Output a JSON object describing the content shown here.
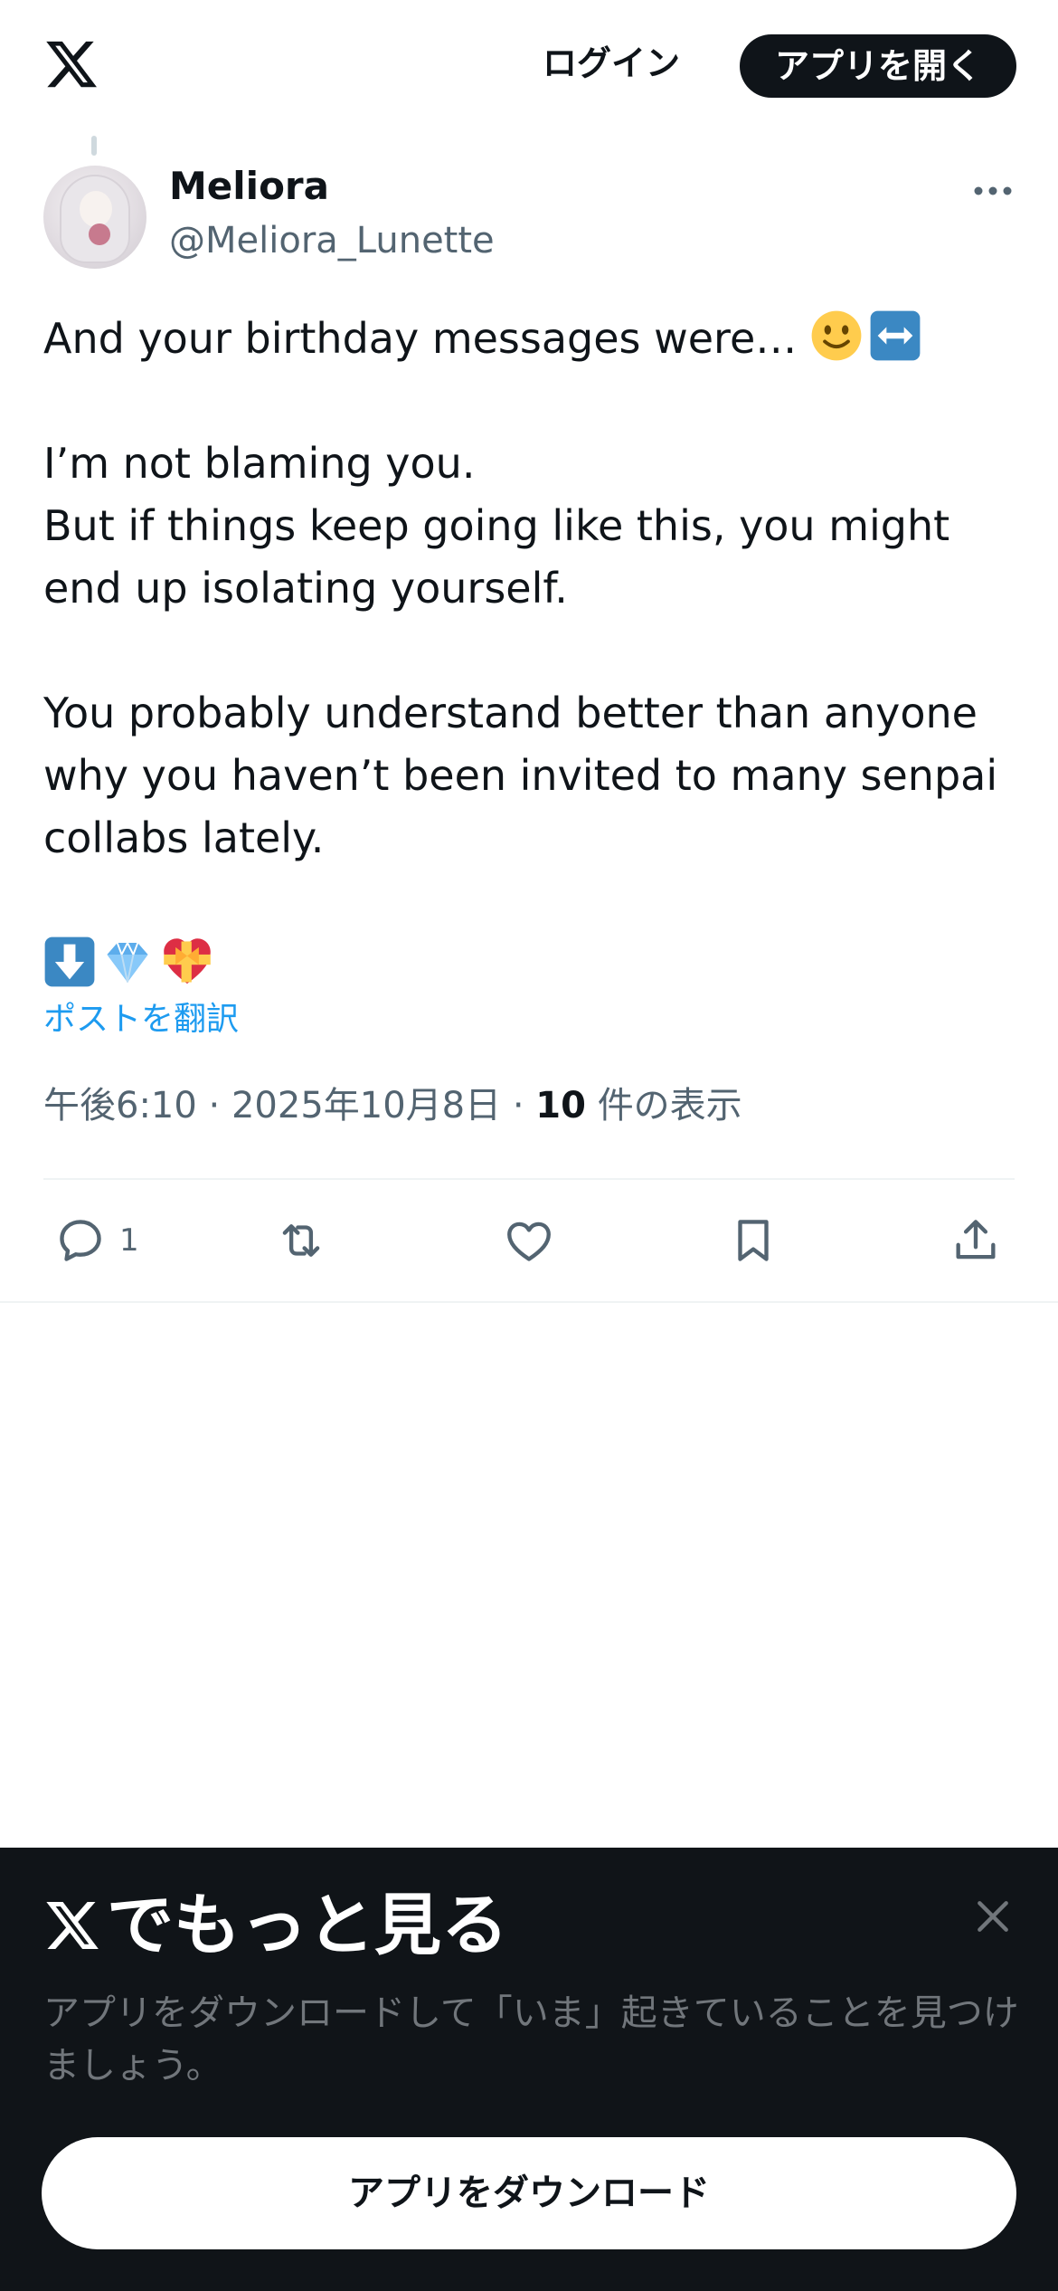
{
  "header": {
    "logo_icon": "x-logo-icon",
    "login_label": "ログイン",
    "open_app_label": "アプリを開く"
  },
  "tweet": {
    "display_name": "Meliora",
    "handle": "@Meliora_Lunette",
    "more_icon": "more-icon",
    "paragraphs": [
      "And your birthday messages were… ",
      "I’m not blaming you.\nBut if things keep going like this, you might end up isolating yourself.",
      "You probably understand better than anyone why you haven’t been invited to many senpai collabs lately."
    ],
    "inline_emojis": [
      "slightly-smiling-face-emoji",
      "left-right-arrow-emoji"
    ],
    "trailing_emojis": [
      "down-arrow-emoji",
      "gem-emoji",
      "heart-with-ribbon-emoji"
    ],
    "translate_label": "ポストを翻訳",
    "time": "午後6:10",
    "date": "2025年10月8日",
    "separator": "·",
    "views_count": "10",
    "views_label": "件の表示"
  },
  "actions": {
    "reply_icon": "reply-icon",
    "reply_count": "1",
    "retweet_icon": "retweet-icon",
    "like_icon": "heart-icon",
    "bookmark_icon": "bookmark-icon",
    "share_icon": "share-icon"
  },
  "promo": {
    "title": "でもっと見る",
    "description": "アプリをダウンロードして「いま」起きていることを見つけましょう。",
    "download_label": "アプリをダウンロード",
    "close_icon": "close-icon"
  },
  "colors": {
    "text_primary": "#0f1419",
    "text_secondary": "#536471",
    "link": "#1d9bf0",
    "promo_bg": "#101418",
    "promo_desc": "#71767b"
  }
}
